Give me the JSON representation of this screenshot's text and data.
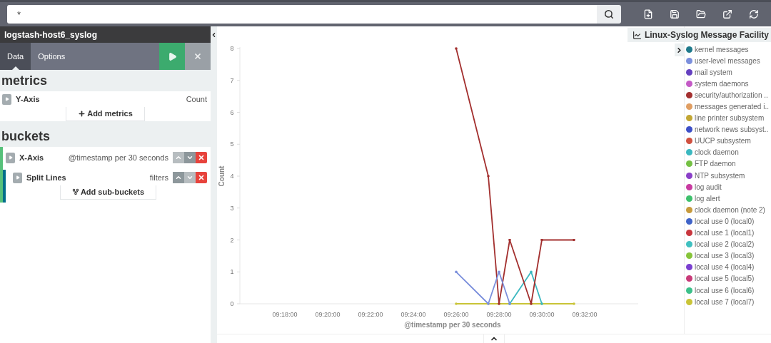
{
  "query_bar": {
    "value": "*"
  },
  "sidebar": {
    "title": "logstash-host6_syslog",
    "tabs": [
      {
        "label": "Data",
        "selected": true
      },
      {
        "label": "Options",
        "selected": false
      }
    ],
    "metrics": {
      "heading": "metrics",
      "rows": [
        {
          "label": "Y-Axis",
          "value": "Count"
        }
      ],
      "add_button": "Add metrics"
    },
    "buckets": {
      "heading": "buckets",
      "rows": [
        {
          "label": "X-Axis",
          "value": "@timestamp per 30 seconds",
          "up_disabled": true,
          "down_disabled": false,
          "color": "#57c17b"
        },
        {
          "label": "Split Lines",
          "value": "filters",
          "up_disabled": false,
          "down_disabled": true,
          "color": "#006e8a"
        }
      ],
      "add_button": "Add sub-buckets"
    }
  },
  "chart": {
    "legend_title": "Linux-Syslog Message Facility",
    "chart_data": {
      "type": "line",
      "xlabel": "@timestamp per 30 seconds",
      "ylabel": "Count",
      "categories": [
        null,
        null,
        null,
        null,
        "09:18:00",
        null,
        null,
        null,
        "09:20:00",
        null,
        null,
        null,
        "09:22:00",
        null,
        null,
        null,
        "09:24:00",
        null,
        null,
        null,
        "09:26:00",
        null,
        null,
        null,
        "09:28:00",
        null,
        null,
        null,
        "09:30:00",
        null,
        null,
        null,
        "09:32:00",
        null,
        null,
        null
      ],
      "series": [
        {
          "name": "kernel messages",
          "color": "#1f7a8c",
          "values": [
            null,
            null,
            null,
            null,
            null,
            null,
            null,
            null,
            null,
            null,
            null,
            null,
            null,
            null,
            null,
            null,
            null,
            null,
            null,
            null,
            null,
            null,
            null,
            null,
            null,
            null,
            null,
            null,
            null,
            null,
            null,
            null,
            null,
            null,
            null,
            null
          ]
        },
        {
          "name": "user-level messages",
          "color": "#7b8fdc",
          "values": [
            null,
            null,
            null,
            null,
            null,
            null,
            null,
            null,
            null,
            null,
            null,
            null,
            null,
            null,
            null,
            null,
            null,
            null,
            null,
            null,
            1,
            null,
            null,
            0,
            1,
            0,
            null,
            null,
            null,
            null,
            null,
            null,
            null,
            null,
            null,
            null
          ]
        },
        {
          "name": "mail system",
          "color": "#6440c0",
          "values": [
            null,
            null,
            null,
            null,
            null,
            null,
            null,
            null,
            null,
            null,
            null,
            null,
            null,
            null,
            null,
            null,
            null,
            null,
            null,
            null,
            null,
            null,
            null,
            null,
            null,
            null,
            null,
            null,
            null,
            null,
            null,
            null,
            null,
            null,
            null,
            null
          ]
        },
        {
          "name": "system daemons",
          "color": "#c45ac6",
          "values": [
            null,
            null,
            null,
            null,
            null,
            null,
            null,
            null,
            null,
            null,
            null,
            null,
            null,
            null,
            null,
            null,
            null,
            null,
            null,
            null,
            null,
            null,
            null,
            null,
            null,
            null,
            null,
            null,
            null,
            null,
            null,
            null,
            null,
            null,
            null,
            null
          ]
        },
        {
          "name": "security/authorization ..",
          "color": "#a3302f",
          "values": [
            null,
            null,
            null,
            null,
            null,
            null,
            null,
            null,
            null,
            null,
            null,
            null,
            null,
            null,
            null,
            null,
            null,
            null,
            null,
            null,
            8,
            null,
            null,
            4,
            0,
            2,
            null,
            0,
            2,
            null,
            null,
            2,
            null,
            null,
            null,
            null
          ]
        },
        {
          "name": "messages generated i..",
          "color": "#e09e62",
          "values": [
            null,
            null,
            null,
            null,
            null,
            null,
            null,
            null,
            null,
            null,
            null,
            null,
            null,
            null,
            null,
            null,
            null,
            null,
            null,
            null,
            null,
            null,
            null,
            null,
            null,
            null,
            null,
            null,
            null,
            null,
            null,
            null,
            null,
            null,
            null,
            null
          ]
        },
        {
          "name": "line printer subsystem",
          "color": "#c2a633",
          "values": [
            null,
            null,
            null,
            null,
            null,
            null,
            null,
            null,
            null,
            null,
            null,
            null,
            null,
            null,
            null,
            null,
            null,
            null,
            null,
            null,
            null,
            null,
            null,
            null,
            null,
            null,
            null,
            null,
            null,
            null,
            null,
            null,
            null,
            null,
            null,
            null
          ]
        },
        {
          "name": "network news subsyst..",
          "color": "#3d4fc7",
          "values": [
            null,
            null,
            null,
            null,
            null,
            null,
            null,
            null,
            null,
            null,
            null,
            null,
            null,
            null,
            null,
            null,
            null,
            null,
            null,
            null,
            null,
            null,
            null,
            null,
            null,
            null,
            null,
            null,
            null,
            null,
            null,
            null,
            null,
            null,
            null,
            null
          ]
        },
        {
          "name": "UUCP subsystem",
          "color": "#d0503f",
          "values": [
            null,
            null,
            null,
            null,
            null,
            null,
            null,
            null,
            null,
            null,
            null,
            null,
            null,
            null,
            null,
            null,
            null,
            null,
            null,
            null,
            null,
            null,
            null,
            null,
            null,
            null,
            null,
            null,
            null,
            null,
            null,
            null,
            null,
            null,
            null,
            null
          ]
        },
        {
          "name": "clock daemon",
          "color": "#3bb8c0",
          "values": [
            null,
            null,
            null,
            null,
            null,
            null,
            null,
            null,
            null,
            null,
            null,
            null,
            null,
            null,
            null,
            null,
            null,
            null,
            null,
            null,
            null,
            null,
            null,
            null,
            null,
            0,
            null,
            1,
            0,
            null,
            null,
            null,
            null,
            null,
            null,
            null
          ]
        },
        {
          "name": "FTP daemon",
          "color": "#74c043",
          "values": [
            null,
            null,
            null,
            null,
            null,
            null,
            null,
            null,
            null,
            null,
            null,
            null,
            null,
            null,
            null,
            null,
            null,
            null,
            null,
            null,
            null,
            null,
            null,
            null,
            null,
            null,
            null,
            null,
            null,
            null,
            null,
            null,
            null,
            null,
            null,
            null
          ]
        },
        {
          "name": "NTP subsystem",
          "color": "#8a3fc8",
          "values": [
            null,
            null,
            null,
            null,
            null,
            null,
            null,
            null,
            null,
            null,
            null,
            null,
            null,
            null,
            null,
            null,
            null,
            null,
            null,
            null,
            null,
            null,
            null,
            null,
            null,
            null,
            null,
            null,
            null,
            null,
            null,
            null,
            null,
            null,
            null,
            null
          ]
        },
        {
          "name": "log audit",
          "color": "#c83aa0",
          "values": [
            null,
            null,
            null,
            null,
            null,
            null,
            null,
            null,
            null,
            null,
            null,
            null,
            null,
            null,
            null,
            null,
            null,
            null,
            null,
            null,
            null,
            null,
            null,
            null,
            null,
            null,
            null,
            null,
            null,
            null,
            null,
            null,
            null,
            null,
            null,
            null
          ]
        },
        {
          "name": "log alert",
          "color": "#3ec06c",
          "values": [
            null,
            null,
            null,
            null,
            null,
            null,
            null,
            null,
            null,
            null,
            null,
            null,
            null,
            null,
            null,
            null,
            null,
            null,
            null,
            null,
            null,
            null,
            null,
            null,
            null,
            null,
            null,
            null,
            null,
            null,
            null,
            null,
            null,
            null,
            null,
            null
          ]
        },
        {
          "name": "clock daemon (note 2)",
          "color": "#c79a3c",
          "values": [
            null,
            null,
            null,
            null,
            null,
            null,
            null,
            null,
            null,
            null,
            null,
            null,
            null,
            null,
            null,
            null,
            null,
            null,
            null,
            null,
            null,
            null,
            null,
            null,
            null,
            null,
            null,
            null,
            null,
            null,
            null,
            null,
            null,
            null,
            null,
            null
          ]
        },
        {
          "name": "local use 0 (local0)",
          "color": "#3f63c8",
          "values": [
            null,
            null,
            null,
            null,
            null,
            null,
            null,
            null,
            null,
            null,
            null,
            null,
            null,
            null,
            null,
            null,
            null,
            null,
            null,
            null,
            null,
            null,
            null,
            null,
            null,
            null,
            null,
            null,
            null,
            null,
            null,
            null,
            null,
            null,
            null,
            null
          ]
        },
        {
          "name": "local use 1 (local1)",
          "color": "#c8363d",
          "values": [
            null,
            null,
            null,
            null,
            null,
            null,
            null,
            null,
            null,
            null,
            null,
            null,
            null,
            null,
            null,
            null,
            null,
            null,
            null,
            null,
            null,
            null,
            null,
            null,
            null,
            null,
            null,
            null,
            null,
            null,
            null,
            null,
            null,
            null,
            null,
            null
          ]
        },
        {
          "name": "local use 2 (local2)",
          "color": "#3fc0c0",
          "values": [
            null,
            null,
            null,
            null,
            null,
            null,
            null,
            null,
            null,
            null,
            null,
            null,
            null,
            null,
            null,
            null,
            null,
            null,
            null,
            null,
            null,
            null,
            null,
            null,
            null,
            null,
            null,
            null,
            null,
            null,
            null,
            null,
            null,
            null,
            null,
            null
          ]
        },
        {
          "name": "local use 3 (local3)",
          "color": "#86c43a",
          "values": [
            null,
            null,
            null,
            null,
            null,
            null,
            null,
            null,
            null,
            null,
            null,
            null,
            null,
            null,
            null,
            null,
            null,
            null,
            null,
            null,
            null,
            null,
            null,
            null,
            null,
            null,
            null,
            null,
            null,
            null,
            null,
            null,
            null,
            null,
            null,
            null
          ]
        },
        {
          "name": "local use 4 (local4)",
          "color": "#7a3fd0",
          "values": [
            null,
            null,
            null,
            null,
            null,
            null,
            null,
            null,
            null,
            null,
            null,
            null,
            null,
            null,
            null,
            null,
            null,
            null,
            null,
            null,
            null,
            null,
            null,
            null,
            null,
            null,
            null,
            null,
            null,
            null,
            null,
            null,
            null,
            null,
            null,
            null
          ]
        },
        {
          "name": "local use 5 (local5)",
          "color": "#c83a78",
          "values": [
            null,
            null,
            null,
            null,
            null,
            null,
            null,
            null,
            null,
            null,
            null,
            null,
            null,
            null,
            null,
            null,
            null,
            null,
            null,
            null,
            null,
            null,
            null,
            null,
            null,
            null,
            null,
            null,
            null,
            null,
            null,
            null,
            null,
            null,
            null,
            null
          ]
        },
        {
          "name": "local use 6 (local6)",
          "color": "#3cc08a",
          "values": [
            null,
            null,
            null,
            null,
            null,
            null,
            null,
            null,
            null,
            null,
            null,
            null,
            null,
            null,
            null,
            null,
            null,
            null,
            null,
            null,
            null,
            null,
            null,
            null,
            null,
            null,
            null,
            null,
            null,
            null,
            null,
            null,
            null,
            null,
            null,
            null
          ]
        },
        {
          "name": "local use 7 (local7)",
          "color": "#c9c437",
          "values": [
            null,
            null,
            null,
            null,
            null,
            null,
            null,
            null,
            null,
            null,
            null,
            null,
            null,
            null,
            null,
            null,
            null,
            null,
            null,
            null,
            0,
            null,
            null,
            0,
            0,
            0,
            null,
            0,
            0,
            null,
            null,
            0,
            null,
            null,
            null,
            null
          ]
        }
      ],
      "ylim": [
        0,
        8
      ],
      "yticks": [
        0,
        1,
        2,
        3,
        4,
        5,
        6,
        7,
        8
      ]
    }
  }
}
